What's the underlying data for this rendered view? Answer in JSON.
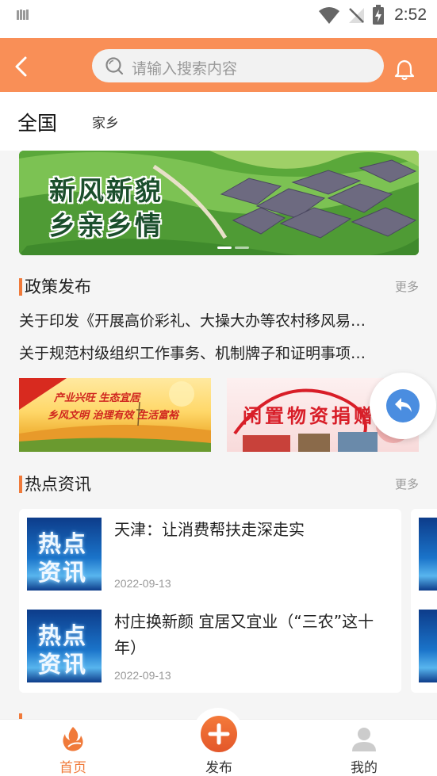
{
  "status_bar": {
    "time": "2:52"
  },
  "header": {
    "search_placeholder": "请输入搜索内容"
  },
  "region_tabs": {
    "national": "全国",
    "hometown": "家乡"
  },
  "banner": {
    "line1": "新风新貌",
    "line2": "乡亲乡情"
  },
  "policy": {
    "title": "政策发布",
    "more": "更多",
    "items": [
      "关于印发《开展高价彩礼、大操大办等农村移风易…",
      "关于规范村级组织工作事务、机制牌子和证明事项…"
    ],
    "banners": [
      {
        "line1": "产业兴旺  生态宜居",
        "line2": "乡风文明  治理有效  生活富裕"
      },
      {
        "text": "闲置物资捐赠"
      }
    ]
  },
  "hot_news": {
    "title": "热点资讯",
    "more": "更多",
    "thumb_line1": "热点",
    "thumb_line2": "资讯",
    "items": [
      {
        "title": "天津：让消费帮扶走深走实",
        "date": "2022-09-13"
      },
      {
        "title": "村庄换新颜 宜居又宜业（“三农”这十年）",
        "date": "2022-09-13"
      }
    ]
  },
  "bottom_nav": {
    "home": "首页",
    "publish": "发布",
    "mine": "我的"
  },
  "colors": {
    "accent": "#f98f57",
    "active_tab": "#f07a3a",
    "float_button": "#4a8de0"
  }
}
